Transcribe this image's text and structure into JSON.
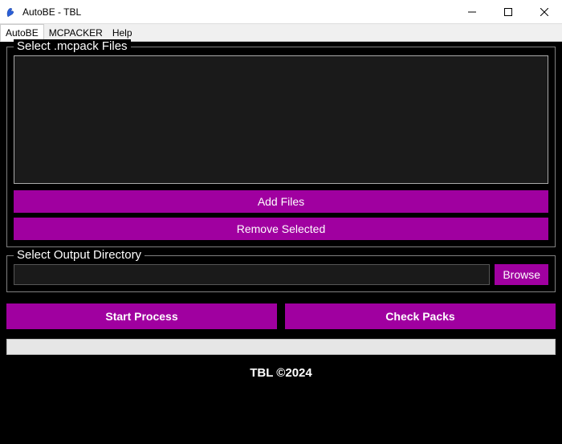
{
  "window": {
    "title": "AutoBE - TBL"
  },
  "menu": {
    "items": [
      "AutoBE",
      "MCPACKER",
      "Help"
    ]
  },
  "files_section": {
    "legend": "Select .mcpack Files",
    "add_button": "Add Files",
    "remove_button": "Remove Selected"
  },
  "output_section": {
    "legend": "Select Output Directory",
    "path": "",
    "browse_button": "Browse"
  },
  "actions": {
    "start": "Start Process",
    "check": "Check Packs"
  },
  "footer": {
    "text": "TBL ©2024"
  },
  "colors": {
    "accent": "#a000a0",
    "bg": "#000000"
  }
}
